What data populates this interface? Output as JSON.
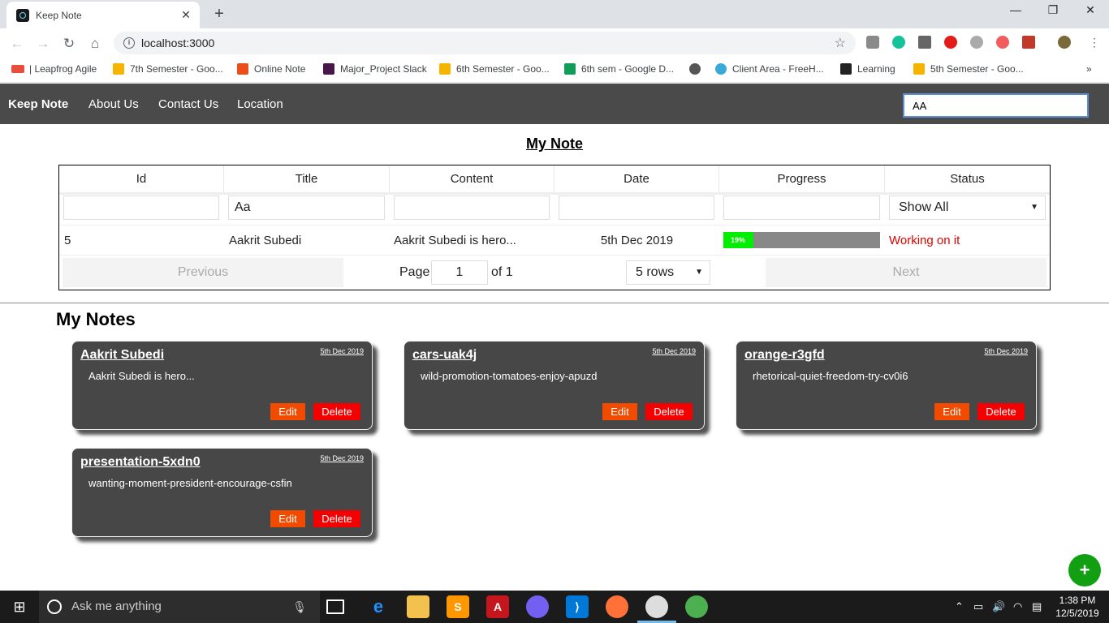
{
  "browser": {
    "tab_title": "Keep Note",
    "url": "localhost:3000",
    "bookmarks": [
      {
        "label": "| Leapfrog Agile"
      },
      {
        "label": "7th Semester - Goo..."
      },
      {
        "label": "Online Note"
      },
      {
        "label": "Major_Project Slack"
      },
      {
        "label": "6th Semester - Goo..."
      },
      {
        "label": "6th sem - Google D..."
      },
      {
        "label": ""
      },
      {
        "label": "Client Area - FreeH..."
      },
      {
        "label": "Learning"
      },
      {
        "label": "5th Semester - Goo..."
      }
    ],
    "more_bookmarks": "»"
  },
  "nav": {
    "brand": "Keep Note",
    "links": [
      "About Us",
      "Contact Us",
      "Location"
    ],
    "search_value": "AA"
  },
  "table": {
    "title": "My Note",
    "columns": [
      "Id",
      "Title",
      "Content",
      "Date",
      "Progress",
      "Status"
    ],
    "filters": {
      "title": "Aa",
      "status": "Show All"
    },
    "rows": [
      {
        "id": "5",
        "title": "Aakrit Subedi",
        "content": "Aakrit Subedi is hero...",
        "date": "5th Dec 2019",
        "progress": 19,
        "progress_label": "19%",
        "status": "Working on it"
      }
    ],
    "pagination": {
      "previous": "Previous",
      "page_label": "Page",
      "page": "1",
      "of_label": "of 1",
      "rows_option": "5 rows",
      "next": "Next"
    }
  },
  "notes": {
    "heading": "My Notes",
    "edit_label": "Edit",
    "delete_label": "Delete",
    "items": [
      {
        "title": "Aakrit Subedi",
        "date": "5th Dec 2019",
        "content": "Aakrit Subedi is hero..."
      },
      {
        "title": "cars-uak4j",
        "date": "5th Dec 2019",
        "content": "wild-promotion-tomatoes-enjoy-apuzd"
      },
      {
        "title": "orange-r3gfd",
        "date": "5th Dec 2019",
        "content": "rhetorical-quiet-freedom-try-cv0i6"
      },
      {
        "title": "presentation-5xdn0",
        "date": "5th Dec 2019",
        "content": "wanting-moment-president-encourage-csfin"
      }
    ]
  },
  "fab": {
    "label": "+"
  },
  "taskbar": {
    "search_placeholder": "Ask me anything",
    "time": "1:38 PM",
    "date": "12/5/2019"
  },
  "colors": {
    "navbar": "#4a4a4a",
    "card": "#474747",
    "edit": "#f24b00",
    "delete": "#f50000",
    "status_text": "#e00000",
    "progress_fill": "#00ee00",
    "fab": "#12a012"
  },
  "icons": [
    "react-icon",
    "back-icon",
    "forward-icon",
    "reload-icon",
    "home-icon",
    "info-icon",
    "star-icon",
    "plus-icon",
    "windows-icon",
    "search-icon",
    "mic-icon"
  ]
}
